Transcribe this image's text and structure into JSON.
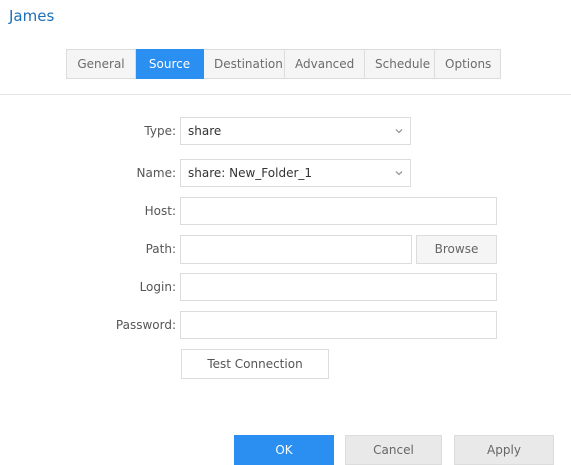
{
  "dialog": {
    "title": "James"
  },
  "tabs": [
    {
      "label": "General"
    },
    {
      "label": "Source"
    },
    {
      "label": "Destination"
    },
    {
      "label": "Advanced"
    },
    {
      "label": "Schedule"
    },
    {
      "label": "Options"
    }
  ],
  "active_tab": "Source",
  "form": {
    "type": {
      "label": "Type:",
      "value": "share"
    },
    "name": {
      "label": "Name:",
      "value": "share: New_Folder_1"
    },
    "host": {
      "label": "Host:",
      "value": ""
    },
    "path": {
      "label": "Path:",
      "value": ""
    },
    "login": {
      "label": "Login:",
      "value": ""
    },
    "password": {
      "label": "Password:",
      "value": ""
    }
  },
  "buttons": {
    "browse": "Browse",
    "test_connection": "Test Connection",
    "ok": "OK",
    "cancel": "Cancel",
    "apply": "Apply"
  },
  "icons": {
    "dropdown": "chevron-down-icon"
  },
  "colors": {
    "accent": "#2a8ff0",
    "title": "#1d6fb8"
  }
}
